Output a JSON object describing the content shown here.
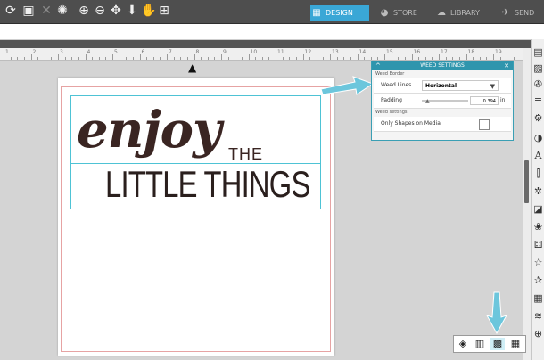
{
  "toolbar": {
    "icons": [
      "refresh-icon",
      "select-icon",
      "close-x-icon",
      "ungroup-icon",
      "zoom-in-icon",
      "zoom-out-icon",
      "pan-icon",
      "move-down-icon",
      "hand-icon",
      "fit-page-icon"
    ]
  },
  "tabs": [
    {
      "label": "DESIGN",
      "icon": "design-grid-icon",
      "active": true
    },
    {
      "label": "STORE",
      "icon": "store-icon",
      "active": false
    },
    {
      "label": "LIBRARY",
      "icon": "cloud-library-icon",
      "active": false
    },
    {
      "label": "SEND",
      "icon": "send-icon",
      "active": false
    }
  ],
  "ruler": {
    "labels": [
      "1",
      "2",
      "3",
      "4",
      "5",
      "6",
      "7",
      "8",
      "9",
      "10",
      "11",
      "12",
      "13",
      "14",
      "15",
      "16",
      "17",
      "18",
      "19"
    ]
  },
  "design": {
    "line1": "enjoy",
    "line2": "THE",
    "line3": "LITTLE THINGS"
  },
  "weed_panel": {
    "title": "WEED SETTINGS",
    "section1": "Weed Border",
    "weed_lines_label": "Weed Lines",
    "weed_lines_value": "Horizontal",
    "padding_label": "Padding",
    "padding_value": "0.394",
    "padding_unit": "in",
    "section2": "Weed settings",
    "only_shapes_label": "Only Shapes on Media",
    "only_shapes_checked": false
  },
  "sidebar_icons": [
    "page-setup-icon",
    "pixscan-icon",
    "cut-settings-icon",
    "text-lines-icon",
    "gear-icon",
    "half-circle-icon",
    "text-style-icon",
    "align-icon",
    "replicate-icon",
    "nest-icon",
    "image-effects-icon",
    "trace-icon",
    "star-outline-icon",
    "star-outline-2-icon",
    "layers-icon",
    "pattern-icon",
    "globe-icon"
  ],
  "bottom_toolbar_icons": [
    "fill-icon",
    "book-icon",
    "weed-icon",
    "grid-icon"
  ],
  "colors": {
    "accent": "#3aa7d6",
    "toolbar_bg": "#4e4e4e",
    "cut_border": "#e6a3a3",
    "bounding_box": "#4ec3d5",
    "arrow_annotation": "#6cc6dc"
  }
}
